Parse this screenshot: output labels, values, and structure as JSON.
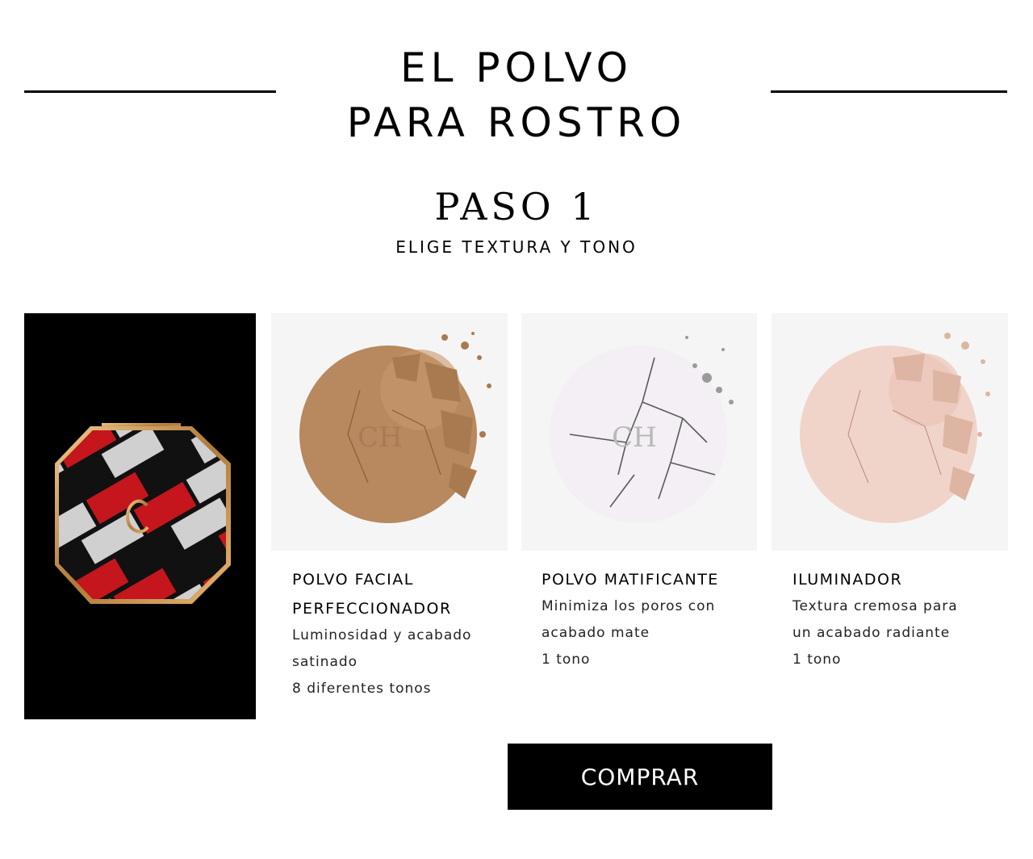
{
  "header": {
    "title_line1": "EL POLVO",
    "title_line2": "PARA ROSTRO"
  },
  "step": {
    "title": "PASO 1",
    "subtitle": "ELIGE TEXTURA Y TONO"
  },
  "products": [
    {
      "title_line1": "POLVO FACIAL",
      "title_line2": "PERFECCIONADOR",
      "description_line1": "Luminosidad y acabado",
      "description_line2": "satinado",
      "tones": "8 diferentes tonos",
      "color": "#b8885e"
    },
    {
      "title_line1": "POLVO MATIFICANTE",
      "description_line1": "Minimiza los poros con",
      "description_line2": "acabado mate",
      "tones": "1 tono",
      "color": "#f3eff4"
    },
    {
      "title_line1": "ILUMINADOR",
      "description_line1": "Textura cremosa para",
      "description_line2": "un acabado radiante",
      "tones": "1 tono",
      "color": "#f1d4c9"
    }
  ],
  "cta": {
    "label": "COMPRAR"
  },
  "colors": {
    "hero_background": "#000000",
    "compact_red": "#c4161c",
    "compact_gold": "#c8955a",
    "compact_grey": "#c9c9c9"
  }
}
